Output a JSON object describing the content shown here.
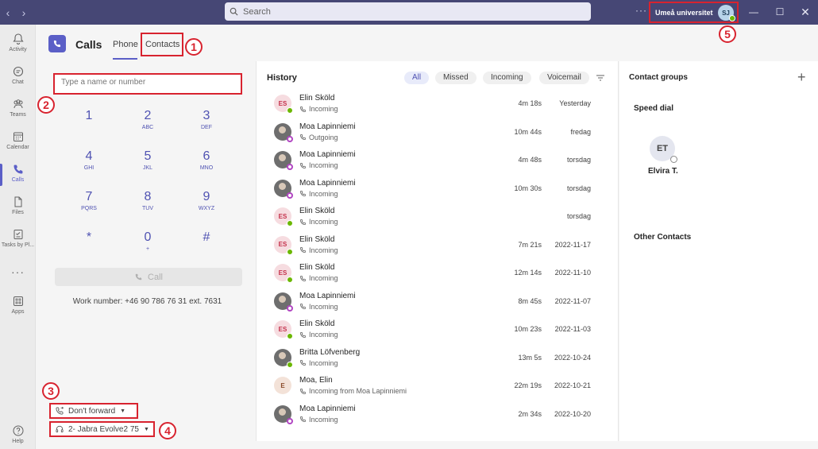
{
  "titlebar": {
    "search_placeholder": "Search",
    "more_label": "···",
    "org_name": "Umeå universitet",
    "user_initials": "SJ"
  },
  "rail": [
    {
      "label": "Activity",
      "icon": "bell-icon"
    },
    {
      "label": "Chat",
      "icon": "chat-icon"
    },
    {
      "label": "Teams",
      "icon": "teams-icon"
    },
    {
      "label": "Calendar",
      "icon": "calendar-icon"
    },
    {
      "label": "Calls",
      "icon": "phone-icon"
    },
    {
      "label": "Files",
      "icon": "file-icon"
    },
    {
      "label": "Tasks by Pl...",
      "icon": "tasks-icon"
    },
    {
      "label": "Apps",
      "icon": "apps-icon"
    },
    {
      "label": "Help",
      "icon": "help-icon"
    }
  ],
  "header": {
    "title": "Calls",
    "tabs": [
      "Phone",
      "Contacts"
    ]
  },
  "markers": [
    "1",
    "2",
    "3",
    "4",
    "5"
  ],
  "dialpad": {
    "input_placeholder": "Type a name or number",
    "keys": [
      {
        "digit": "1",
        "letters": ""
      },
      {
        "digit": "2",
        "letters": "ABC"
      },
      {
        "digit": "3",
        "letters": "DEF"
      },
      {
        "digit": "4",
        "letters": "GHI"
      },
      {
        "digit": "5",
        "letters": "JKL"
      },
      {
        "digit": "6",
        "letters": "MNO"
      },
      {
        "digit": "7",
        "letters": "PQRS"
      },
      {
        "digit": "8",
        "letters": "TUV"
      },
      {
        "digit": "9",
        "letters": "WXYZ"
      },
      {
        "digit": "*",
        "letters": ""
      },
      {
        "digit": "0",
        "letters": "+"
      },
      {
        "digit": "#",
        "letters": ""
      }
    ],
    "call_label": "Call",
    "work_number": "Work number: +46 90 786 76 31 ext. 7631",
    "forward_label": "Don't forward",
    "device_label": "2- Jabra Evolve2 75"
  },
  "history": {
    "title": "History",
    "filters": [
      "All",
      "Missed",
      "Incoming",
      "Voicemail"
    ],
    "rows": [
      {
        "name": "Elin Sköld",
        "initials": "ES",
        "status": "Incoming",
        "duration": "4m 18s",
        "date": "Yesterday",
        "avatar": "initials",
        "presence": "green"
      },
      {
        "name": "Moa Lapinniemi",
        "initials": "",
        "status": "Outgoing",
        "duration": "10m 44s",
        "date": "fredag",
        "avatar": "photo",
        "presence": "purple"
      },
      {
        "name": "Moa Lapinniemi",
        "initials": "",
        "status": "Incoming",
        "duration": "4m 48s",
        "date": "torsdag",
        "avatar": "photo",
        "presence": "purple"
      },
      {
        "name": "Moa Lapinniemi",
        "initials": "",
        "status": "Incoming",
        "duration": "10m 30s",
        "date": "torsdag",
        "avatar": "photo",
        "presence": "purple"
      },
      {
        "name": "Elin Sköld",
        "initials": "ES",
        "status": "Incoming",
        "duration": "",
        "date": "torsdag",
        "avatar": "initials",
        "presence": "green"
      },
      {
        "name": "Elin Sköld",
        "initials": "ES",
        "status": "Incoming",
        "duration": "7m 21s",
        "date": "2022-11-17",
        "avatar": "initials",
        "presence": "green"
      },
      {
        "name": "Elin Sköld",
        "initials": "ES",
        "status": "Incoming",
        "duration": "12m 14s",
        "date": "2022-11-10",
        "avatar": "initials",
        "presence": "green"
      },
      {
        "name": "Moa Lapinniemi",
        "initials": "",
        "status": "Incoming",
        "duration": "8m 45s",
        "date": "2022-11-07",
        "avatar": "photo",
        "presence": "purple"
      },
      {
        "name": "Elin Sköld",
        "initials": "ES",
        "status": "Incoming",
        "duration": "10m 23s",
        "date": "2022-11-03",
        "avatar": "initials",
        "presence": "green"
      },
      {
        "name": "Britta Löfvenberg",
        "initials": "",
        "status": "Incoming",
        "duration": "13m 5s",
        "date": "2022-10-24",
        "avatar": "photo",
        "presence": "green"
      },
      {
        "name": "Moa, Elin",
        "initials": "E",
        "status": "Incoming from Moa Lapinniemi",
        "duration": "22m 19s",
        "date": "2022-10-21",
        "avatar": "elin2",
        "presence": ""
      },
      {
        "name": "Moa Lapinniemi",
        "initials": "",
        "status": "Incoming",
        "duration": "2m 34s",
        "date": "2022-10-20",
        "avatar": "photo",
        "presence": "purple"
      }
    ]
  },
  "groups": {
    "title": "Contact groups",
    "speed_dial": "Speed dial",
    "contact_initials": "ET",
    "contact_name": "Elvira T.",
    "other_contacts": "Other Contacts"
  },
  "colors": {
    "titlebar": "#464775",
    "accent": "#5b5fc7",
    "annotation": "#d8232f"
  }
}
